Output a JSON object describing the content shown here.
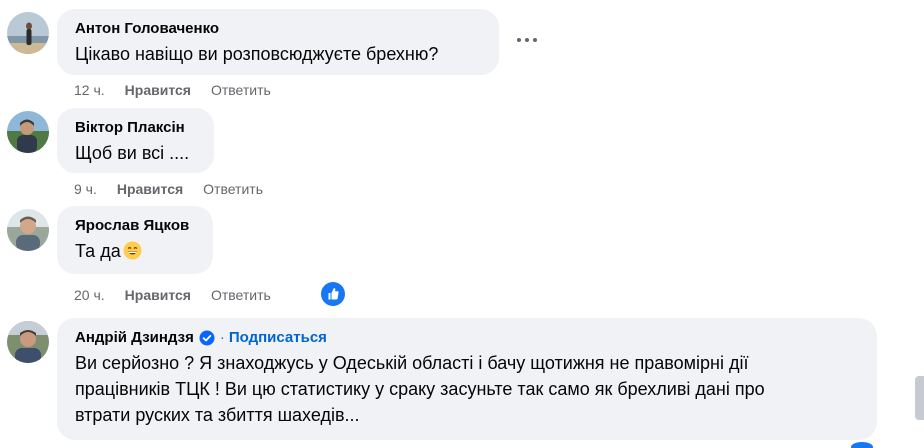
{
  "comments": [
    {
      "author": "Антон Головаченко",
      "text": "Цікаво навіщо ви розповсюджуєте брехню?",
      "time": "12 ч.",
      "like_label": "Нравится",
      "reply_label": "Ответить"
    },
    {
      "author": "Віктор Плаксін",
      "text": "Щоб ви всі ....",
      "time": "9 ч.",
      "like_label": "Нравится",
      "reply_label": "Ответить"
    },
    {
      "author": "Ярослав Яцков",
      "text": "Та да",
      "emoji": "grinning-face-emoji",
      "time": "20 ч.",
      "like_label": "Нравится",
      "reply_label": "Ответить",
      "reaction": "like-reaction-icon"
    },
    {
      "author": "Андрій Дзиндзя",
      "verified": true,
      "separator": "·",
      "follow_label": "Подписаться",
      "text_lines": [
        "Ви серйозно ? Я знаходжусь у Одеській області і бачу щотижня не правомірні дії",
        "працівників ТЦК ! Ви цю статистику у сраку засуньте так само як брехливі дані про",
        "втрати руских та збиття шахедів..."
      ]
    }
  ],
  "colors": {
    "bubble": "#f0f2f5",
    "meta_text": "#65676b",
    "link_blue": "#0064d1",
    "like_blue": "#1877f2"
  },
  "icons": [
    "more-options-icon",
    "verified-badge-icon",
    "like-reaction-icon",
    "grinning-face-emoji"
  ]
}
